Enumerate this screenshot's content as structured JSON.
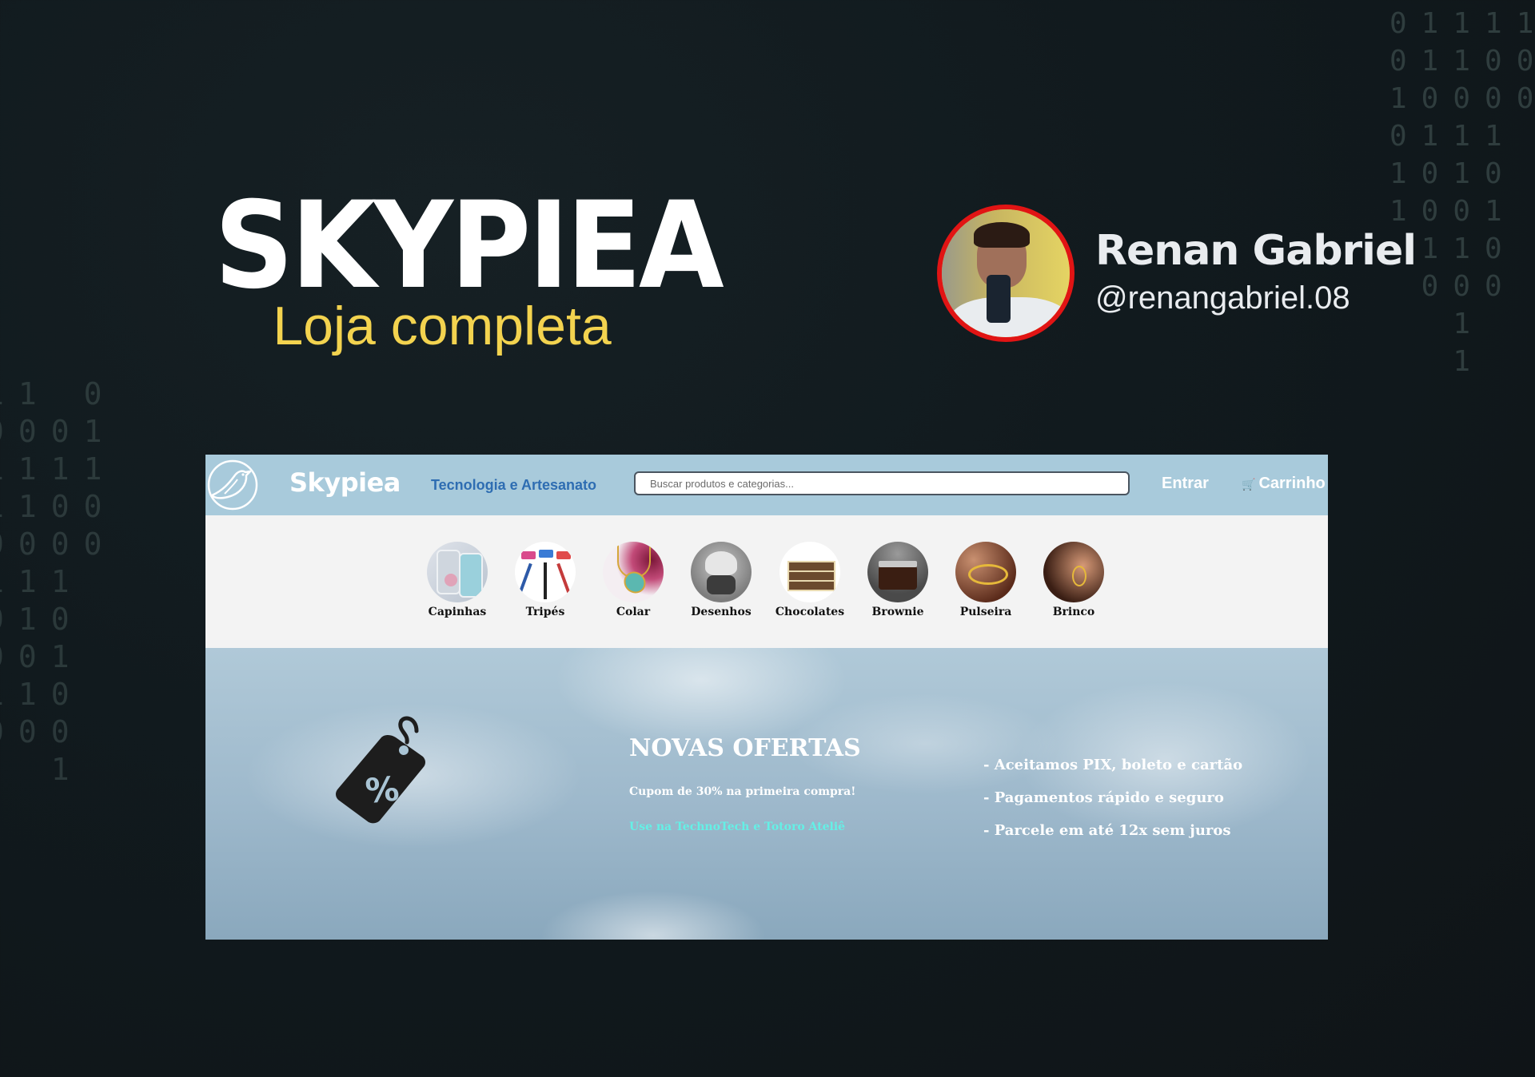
{
  "hero": {
    "title": "SKYPIEA",
    "subtitle": "Loja completa"
  },
  "author": {
    "name": "Renan Gabriel",
    "handle": "@renangabriel.08"
  },
  "decor": {
    "binary_top_right": "01111\n01100\n10000\n0111\n1010\n1001\n 110\n 000\n  1\n  1",
    "binary_left": "11 0\n0001\n1111\n1100\n0000\n111\n010\n001\n110\n000\n  1"
  },
  "site": {
    "brand": "Skypiea",
    "tagline": "Tecnologia e Artesanato",
    "search_placeholder": "Buscar produtos e categorias...",
    "login_label": "Entrar",
    "cart_icon": "cart-icon",
    "cart_label": "Carrinho",
    "categories": [
      {
        "label": "Capinhas"
      },
      {
        "label": "Tripés"
      },
      {
        "label": "Colar"
      },
      {
        "label": "Desenhos"
      },
      {
        "label": "Chocolates"
      },
      {
        "label": "Brownie"
      },
      {
        "label": "Pulseira"
      },
      {
        "label": "Brinco"
      }
    ],
    "banner": {
      "title": "NOVAS OFERTAS",
      "coupon": "Cupom de 30% na primeira compra!",
      "use_on": "Use na TechnoTech e Totoro Ateliê",
      "perks": [
        "- Aceitamos PIX, boleto e cartão",
        "- Pagamentos rápido e seguro",
        "- Parcele em até 12x sem juros"
      ]
    },
    "colors": {
      "navbar": "#a8cadb",
      "tagline": "#2e6db2",
      "accent_cyan": "#64f0e6",
      "hero_yellow": "#f3d34f",
      "avatar_ring": "#e11414"
    }
  }
}
